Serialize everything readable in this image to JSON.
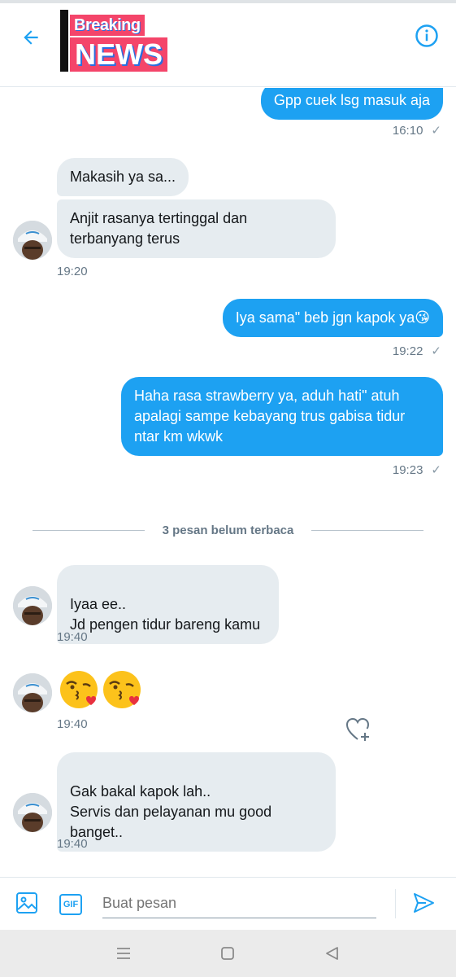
{
  "header": {
    "logo_line1": "Breaking",
    "logo_line2": "NEWS",
    "back_icon": "arrow-left-icon",
    "info_icon": "info-circle-icon",
    "accent_color": "#1da1f2"
  },
  "messages": [
    {
      "direction": "out",
      "text": "Gpp cuek lsg masuk aja",
      "time": "16:10",
      "status": "✓"
    },
    {
      "direction": "in",
      "text": "Makasih ya sa...",
      "time": ""
    },
    {
      "direction": "in",
      "text": "Anjit rasanya tertinggal dan terbanyang terus",
      "time": "19:20"
    },
    {
      "direction": "out",
      "text": "Iya sama\" beb jgn kapok ya😘",
      "time": "19:22",
      "status": "✓"
    },
    {
      "direction": "out",
      "text": "Haha rasa strawberry ya, aduh hati\" atuh apalagi sampe kebayang trus gabisa tidur ntar km wkwk",
      "time": "19:23",
      "status": "✓"
    },
    {
      "direction": "in",
      "text": "Iyaa ee..\nJd pengen tidur bareng kamu",
      "time": "19:40"
    },
    {
      "direction": "in",
      "text": "😘😘",
      "time": "19:40"
    },
    {
      "direction": "in",
      "text": "Gak bakal kapok lah..\nServis dan pelayanan mu good banget..",
      "time": "19:40"
    }
  ],
  "unread_divider": "3 pesan belum terbaca",
  "composer": {
    "placeholder": "Buat pesan",
    "gif_label": "GIF",
    "image_icon": "image-icon",
    "send_icon": "send-icon"
  },
  "navbar": {
    "menu_icon": "menu-icon",
    "home_icon": "square-icon",
    "back_icon": "triangle-back-icon"
  },
  "colors": {
    "outgoing_bubble": "#1da1f2",
    "incoming_bubble": "#e6ecf0",
    "meta_text": "#657786"
  }
}
